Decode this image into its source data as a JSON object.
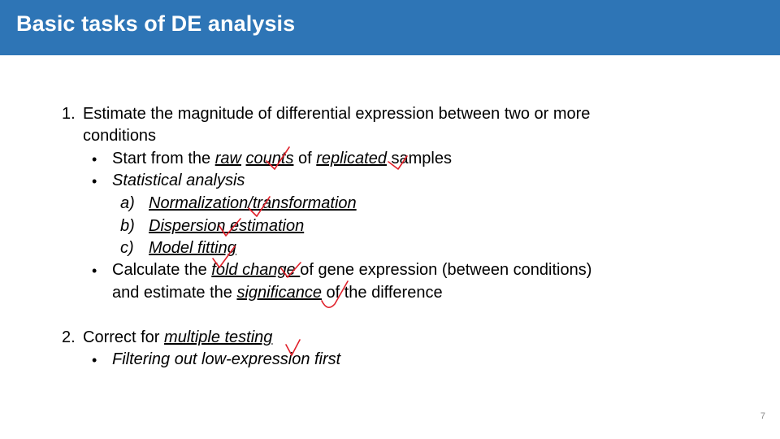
{
  "header": {
    "title": "Basic tasks of DE analysis"
  },
  "items": {
    "one": {
      "num": "1.",
      "line1": "Estimate the magnitude of differential expression between two or more",
      "line2": "conditions",
      "b1": {
        "pre": "Start from the ",
        "raw": "raw",
        "sp1": " ",
        "counts": "counts",
        "mid": " of ",
        "replicated": "replicated",
        "post": " samples"
      },
      "b2": {
        "text": "Statistical analysis"
      },
      "subs": [
        {
          "label": "a)",
          "text": "Normalization/transformation"
        },
        {
          "label": "b)",
          "text": "Dispersion estimation"
        },
        {
          "label": "c)",
          "text": "Model fitting"
        }
      ],
      "b3": {
        "pre": "Calculate the ",
        "fold": "fold change ",
        "post": "of gene expression (between conditions)",
        "l2pre": "and estimate the ",
        "sig": "significance",
        "l2post": " of the difference"
      }
    },
    "two": {
      "num": "2.",
      "pre": "Correct for ",
      "mt": "multiple testing",
      "b1": "Filtering out low-expression first"
    }
  },
  "bullet_char": "•",
  "footer": {
    "page": "7"
  },
  "colors": {
    "header_bg": "#2e75b6",
    "checkmark": "#e0202a"
  }
}
